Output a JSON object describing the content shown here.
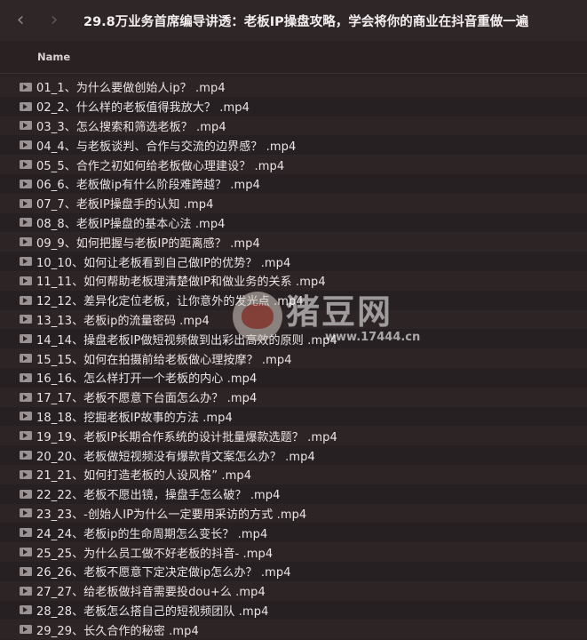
{
  "window": {
    "title": "29.8万业务首席编导讲透：老板IP操盘攻略，学会将你的商业在抖音重做一遍",
    "back_icon": "chevron-left-icon",
    "forward_icon": "chevron-right-icon"
  },
  "table": {
    "column_name": "Name",
    "file_icon": "video-file-icon",
    "files": [
      "01_1、为什么要做创始人ip？ .mp4",
      "02_2、什么样的老板值得我放大？ .mp4",
      "03_3、怎么搜索和筛选老板？ .mp4",
      "04_4、与老板谈判、合作与交流的边界感？ .mp4",
      "05_5、合作之初如何给老板做心理建设？ .mp4",
      "06_6、老板做ip有什么阶段难跨越？ .mp4",
      "07_7、老板IP操盘手的认知 .mp4",
      "08_8、老板IP操盘的基本心法 .mp4",
      "09_9、如何把握与老板IP的距离感？ .mp4",
      "10_10、如何让老板看到自己做IP的优势？ .mp4",
      "11_11、如何帮助老板理清楚做IP和做业务的关系 .mp4",
      "12_12、差异化定位老板，让你意外的发光点 .mp4",
      "13_13、老板ip的流量密码 .mp4",
      "14_14、操盘老板IP做短视频做到出彩出高效的原则 .mp4",
      "15_15、如何在拍摄前给老板做心理按摩？ .mp4",
      "16_16、怎么样打开一个老板的内心 .mp4",
      "17_17、老板不愿意下台面怎么办？ .mp4",
      "18_18、挖掘老板IP故事的方法 .mp4",
      "19_19、老板IP长期合作系统的设计批量爆款选题？ .mp4",
      "20_20、老板做短视频没有爆款背文案怎么办？ .mp4",
      "21_21、如何打造老板的人设风格” .mp4",
      "22_22、老板不愿出镜，操盘手怎么破？ .mp4",
      "23_23、-创始人IP为什么一定要用采访的方式 .mp4",
      "24_24、老板ip的生命周期怎么变长？ .mp4",
      "25_25、为什么员工做不好老板的抖音- .mp4",
      "26_26、老板不愿意下定决定做ip怎么办？ .mp4",
      "27_27、给老板做抖音需要投dou+么 .mp4",
      "28_28、老板怎么搭自己的短视频团队 .mp4",
      "29_29、长久合作的秘密 .mp4"
    ]
  },
  "watermark": {
    "logo_icon": "pig-logo-icon",
    "text": "猪豆网",
    "url": "www.17444.cn"
  }
}
